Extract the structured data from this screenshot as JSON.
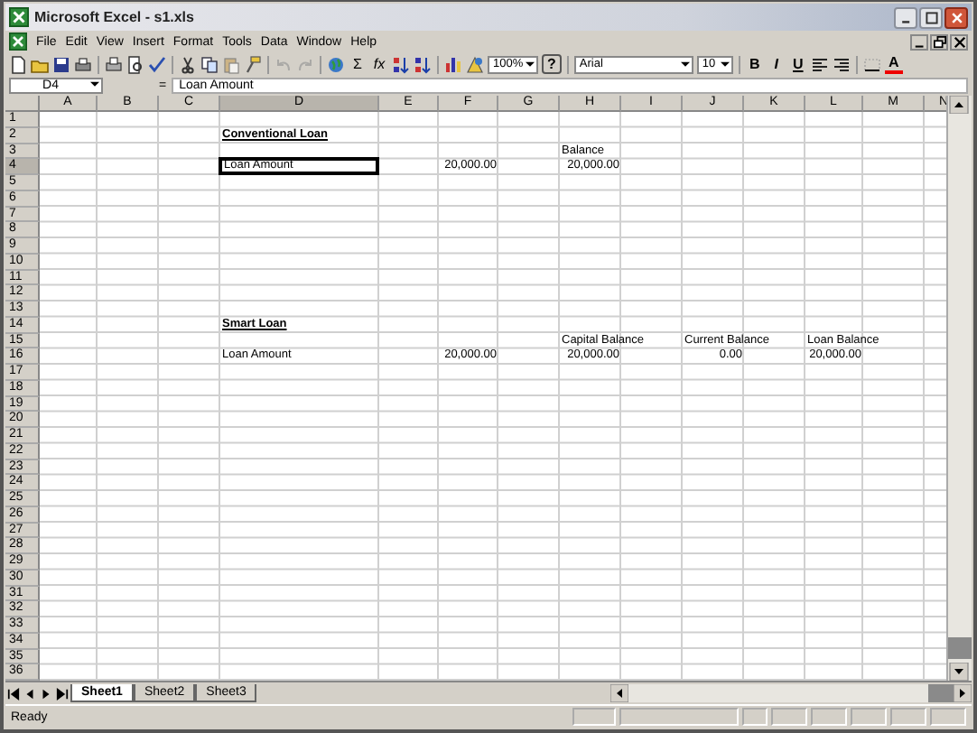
{
  "window": {
    "title": "Microsoft Excel - s1.xls"
  },
  "menu": [
    "File",
    "Edit",
    "View",
    "Insert",
    "Format",
    "Tools",
    "Data",
    "Window",
    "Help"
  ],
  "toolbar": {
    "zoom": "100%",
    "help": "?",
    "font": "Arial",
    "size": "10",
    "sum": "Σ",
    "function": "fx",
    "bold": "B",
    "italic": "I",
    "underline": "U",
    "font_color": "A"
  },
  "formula_bar": {
    "name_box": "D4",
    "equals": "=",
    "value": "Loan Amount"
  },
  "sheet": {
    "columns": [
      "A",
      "B",
      "C",
      "D",
      "E",
      "F",
      "G",
      "H",
      "I",
      "J",
      "K",
      "L",
      "M",
      "N"
    ],
    "rows": [
      {
        "number": "1"
      },
      {
        "number": "2",
        "cells": {
          "D": {
            "text": "Conventional Loan",
            "kind": "heading",
            "selected": false
          }
        }
      },
      {
        "number": "3",
        "cells": {
          "H": {
            "text": "Balance",
            "kind": "text",
            "selected": false
          }
        }
      },
      {
        "number": "4",
        "cells": {
          "D": {
            "text": "Loan Amount",
            "kind": "text",
            "selected": true
          },
          "F": {
            "text": "20,000.00",
            "kind": "number",
            "selected": false
          },
          "H": {
            "text": "20,000.00",
            "kind": "number",
            "selected": false
          }
        }
      },
      {
        "number": "5"
      },
      {
        "number": "6"
      },
      {
        "number": "7"
      },
      {
        "number": "8"
      },
      {
        "number": "9"
      },
      {
        "number": "10"
      },
      {
        "number": "11"
      },
      {
        "number": "12"
      },
      {
        "number": "13"
      },
      {
        "number": "14",
        "cells": {
          "D": {
            "text": "Smart Loan",
            "kind": "heading",
            "selected": false
          }
        }
      },
      {
        "number": "15",
        "cells": {
          "H": {
            "text": "Capital Balance",
            "kind": "text",
            "selected": false
          },
          "J": {
            "text": "Current Balance",
            "kind": "text",
            "selected": false
          },
          "L": {
            "text": "Loan Balance",
            "kind": "text",
            "selected": false
          }
        }
      },
      {
        "number": "16",
        "cells": {
          "D": {
            "text": "Loan Amount",
            "kind": "text",
            "selected": false
          },
          "F": {
            "text": "20,000.00",
            "kind": "number",
            "selected": false
          },
          "H": {
            "text": "20,000.00",
            "kind": "number",
            "selected": false
          },
          "J": {
            "text": "0.00",
            "kind": "number",
            "selected": false
          },
          "L": {
            "text": "20,000.00",
            "kind": "number",
            "selected": false
          }
        }
      },
      {
        "number": "17"
      },
      {
        "number": "18"
      },
      {
        "number": "19"
      },
      {
        "number": "20"
      },
      {
        "number": "21"
      },
      {
        "number": "22"
      },
      {
        "number": "23"
      },
      {
        "number": "24"
      },
      {
        "number": "25"
      },
      {
        "number": "26"
      },
      {
        "number": "27"
      },
      {
        "number": "28"
      },
      {
        "number": "29"
      },
      {
        "number": "30"
      },
      {
        "number": "31"
      },
      {
        "number": "32"
      },
      {
        "number": "33"
      },
      {
        "number": "34"
      },
      {
        "number": "35"
      },
      {
        "number": "36"
      }
    ]
  },
  "sheet_tabs": [
    {
      "label": "Sheet1",
      "selected": true
    },
    {
      "label": "Sheet2",
      "selected": false
    },
    {
      "label": "Sheet3",
      "selected": false
    }
  ],
  "status_bar": {
    "text": "Ready"
  }
}
